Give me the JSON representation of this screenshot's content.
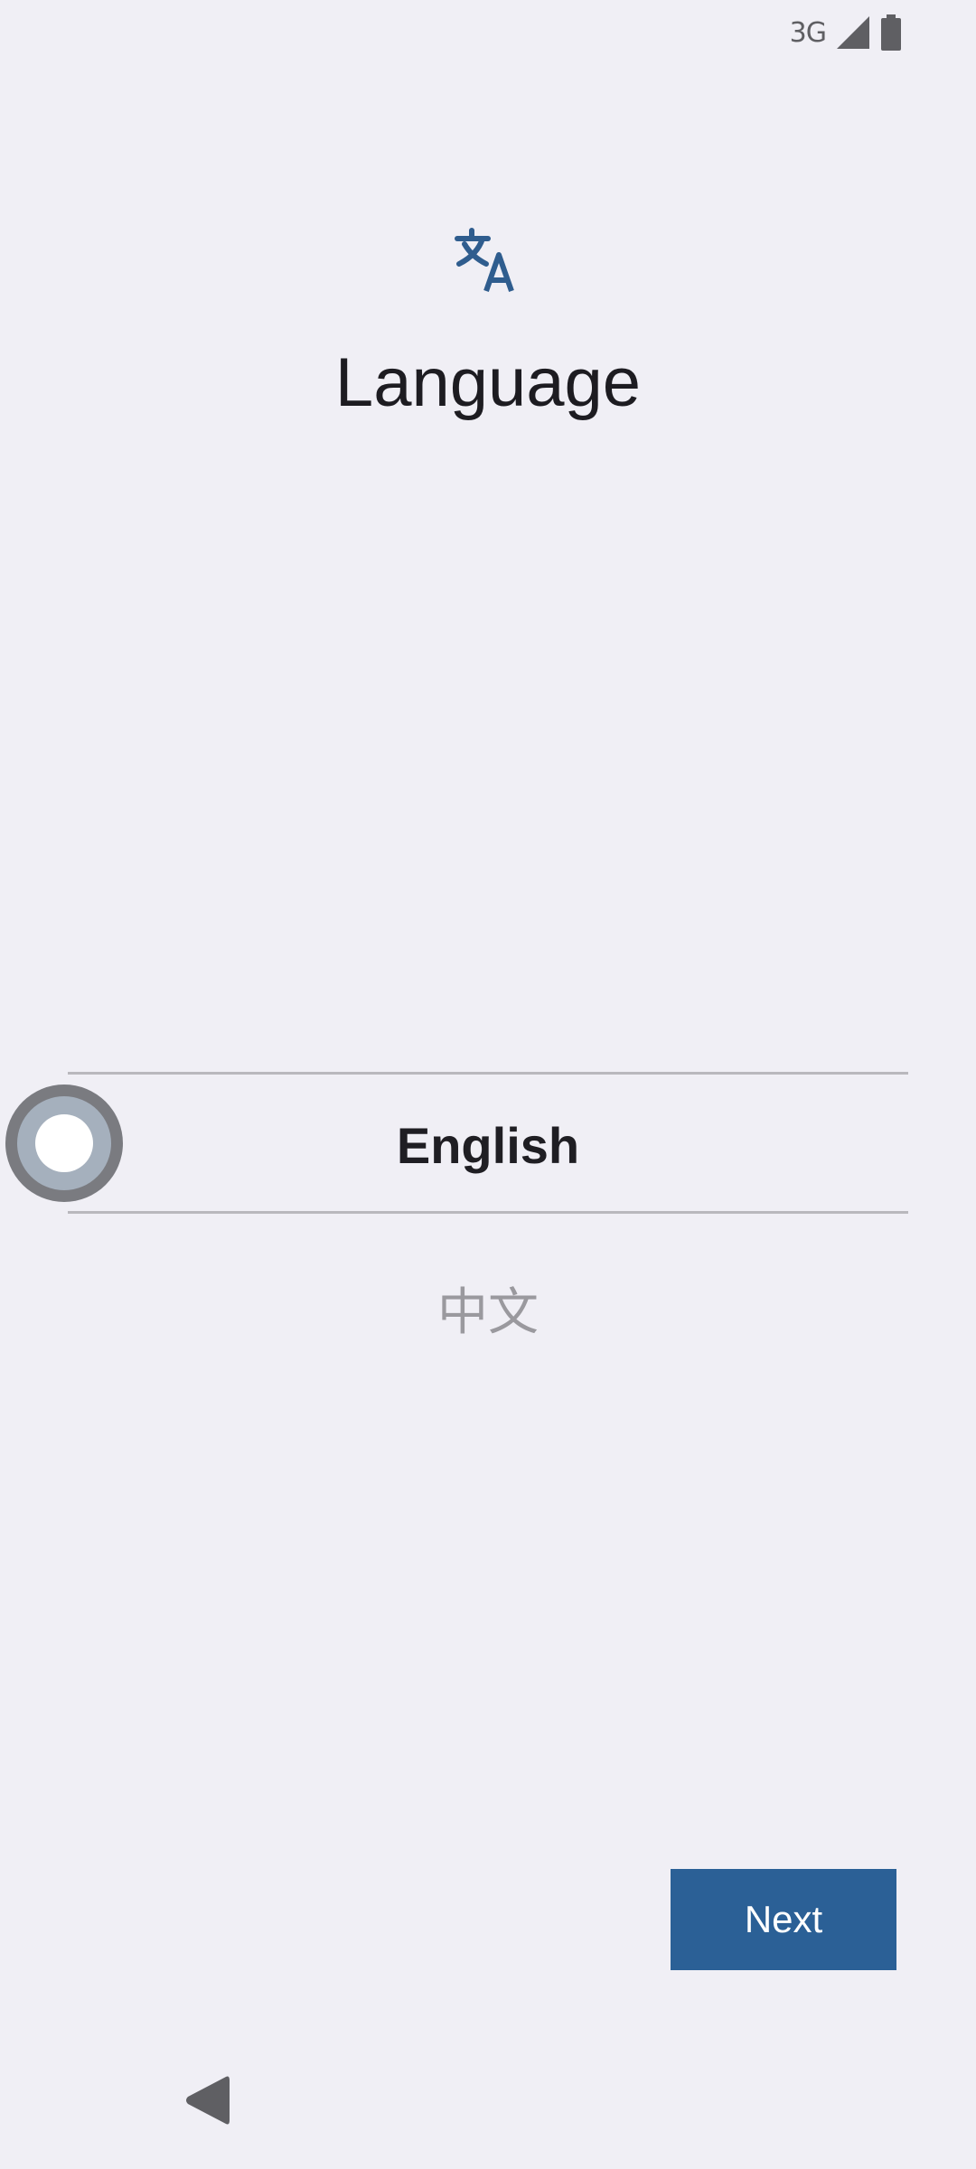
{
  "status_bar": {
    "network": "3G",
    "signal_icon": "cellular-signal-icon",
    "battery_icon": "battery-icon"
  },
  "header": {
    "icon": "translate-icon",
    "title": "Language"
  },
  "picker": {
    "options": [
      {
        "label": "English",
        "selected": true
      },
      {
        "label": "中文",
        "selected": false
      }
    ]
  },
  "actions": {
    "next_label": "Next"
  },
  "navigation": {
    "back_icon": "back-triangle-icon"
  },
  "colors": {
    "background": "#f0eff5",
    "accent": "#2b6096",
    "icon_accent": "#2f5d8e",
    "text_primary": "#1d1c21",
    "text_secondary": "#9a999e",
    "divider": "#b9b8bd"
  }
}
